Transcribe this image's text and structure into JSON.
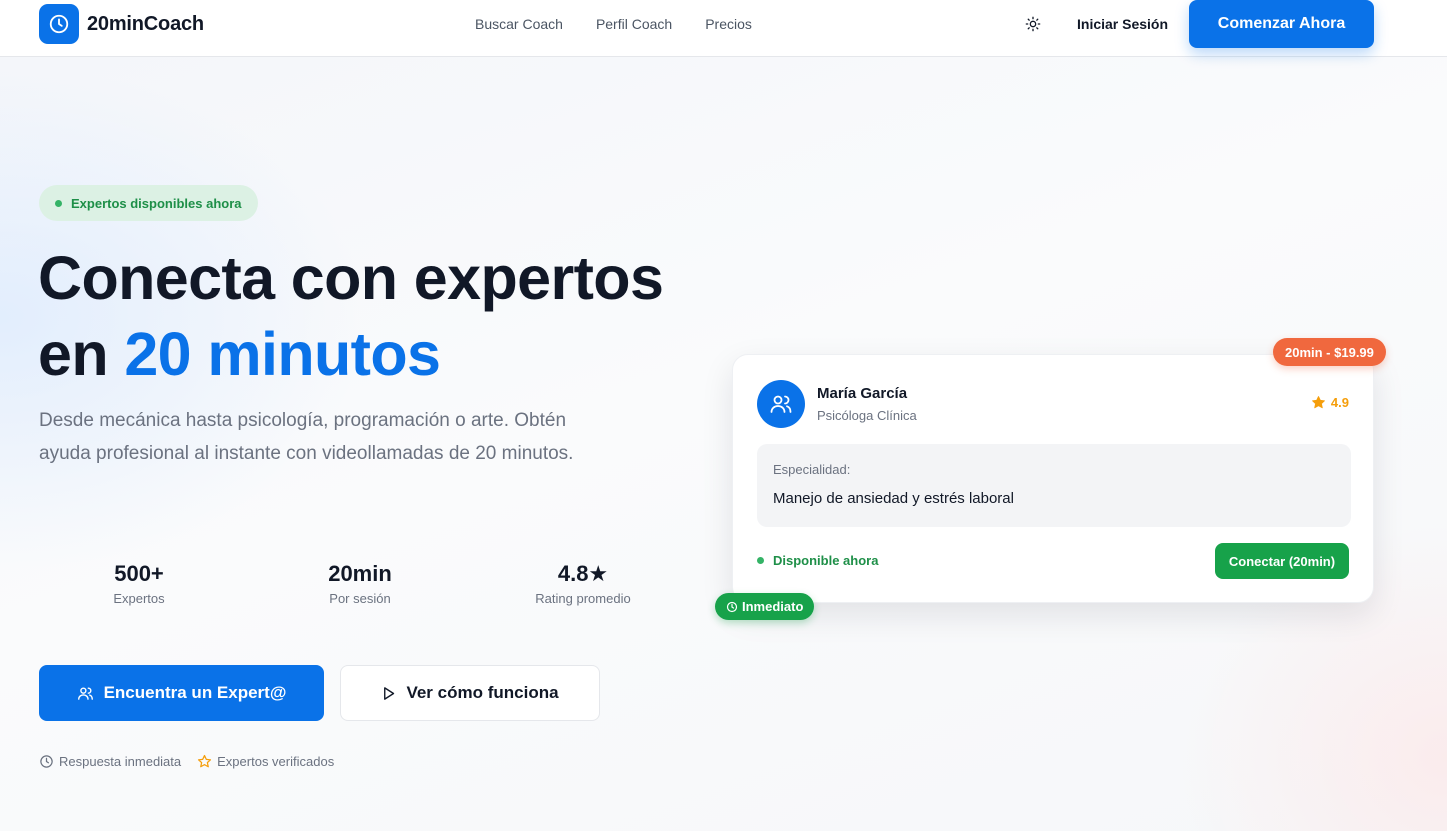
{
  "colors": {
    "brand": "#0a72e8",
    "success": "#17a24a",
    "price_tag": "#f0683e",
    "star": "#f59e0b"
  },
  "header": {
    "logo_icon": "clock-icon",
    "brand_name": "20minCoach",
    "nav": [
      {
        "label": "Buscar Coach"
      },
      {
        "label": "Perfil Coach"
      },
      {
        "label": "Precios"
      }
    ],
    "theme_icon": "sun-icon",
    "login_label": "Iniciar Sesión",
    "cta_label": "Comenzar Ahora"
  },
  "hero": {
    "badge": "Expertos disponibles ahora",
    "title_line1": "Conecta con expertos",
    "title_line2_prefix": "en ",
    "title_line2_accent": "20 minutos",
    "subtitle": "Desde mecánica hasta psicología, programación o arte. Obtén ayuda profesional al instante con videollamadas de 20 minutos.",
    "stats": [
      {
        "value": "500+",
        "label": "Expertos"
      },
      {
        "value": "20min",
        "label": "Por sesión"
      },
      {
        "value": "4.8★",
        "label": "Rating promedio"
      }
    ],
    "primary_button": {
      "icon": "users-icon",
      "label": "Encuentra un Expert@"
    },
    "secondary_button": {
      "icon": "play-icon",
      "label": "Ver cómo funciona"
    },
    "trust": [
      {
        "icon": "clock-icon",
        "label": "Respuesta inmediata"
      },
      {
        "icon": "star-icon",
        "label": "Expertos verificados"
      }
    ]
  },
  "card": {
    "price_tag": "20min - $19.99",
    "avatar_icon": "users-icon",
    "name": "María García",
    "role": "Psicóloga Clínica",
    "rating": "4.9",
    "specialty_label": "Especialidad:",
    "specialty_value": "Manejo de ansiedad y estrés laboral",
    "availability": "Disponible ahora",
    "connect_label": "Conectar (20min)",
    "instant_tag": "Inmediato"
  }
}
